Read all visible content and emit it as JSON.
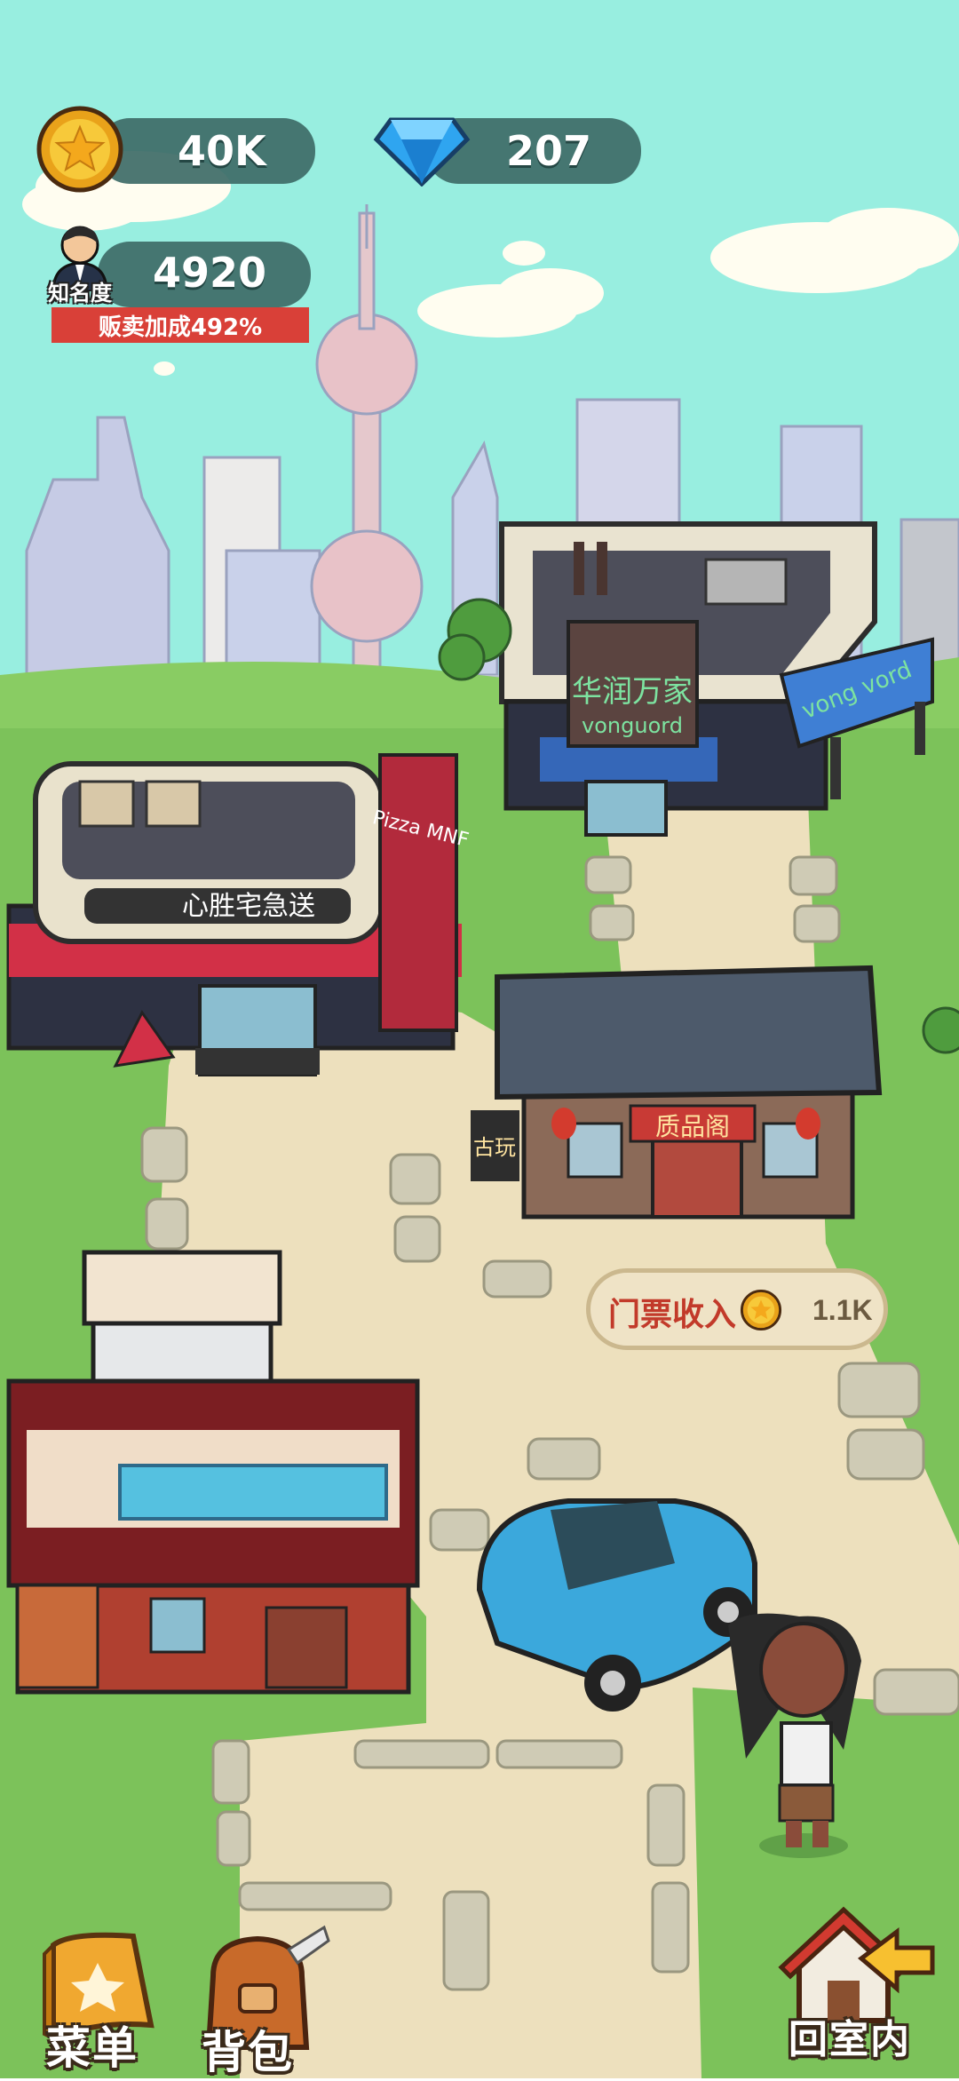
{
  "hud": {
    "coins": "40K",
    "gems": "207",
    "fame_value": "4920",
    "fame_label": "知名度",
    "bonus_text": "贩卖加成492%"
  },
  "ticket_income": {
    "label": "门票收入",
    "value": "1.1K"
  },
  "buildings": {
    "store_sign": "华润万家",
    "store_sub": "vonguord",
    "store_awning": "vong vord",
    "pizza_sign": "心胜宅急送",
    "pizza_banner": "Pizza MNF",
    "antique_sign": "质品阁",
    "antique_side": "古玩"
  },
  "bottom_bar": {
    "menu_label": "菜单",
    "bag_label": "背包",
    "home_label": "回室内"
  },
  "colors": {
    "sky": "#98eee0",
    "grass": "#7cc25a",
    "path": "#ede0bd",
    "hud_pill": "#3e6b67",
    "ribbon": "#d94038",
    "car": "#3ba8dc"
  }
}
